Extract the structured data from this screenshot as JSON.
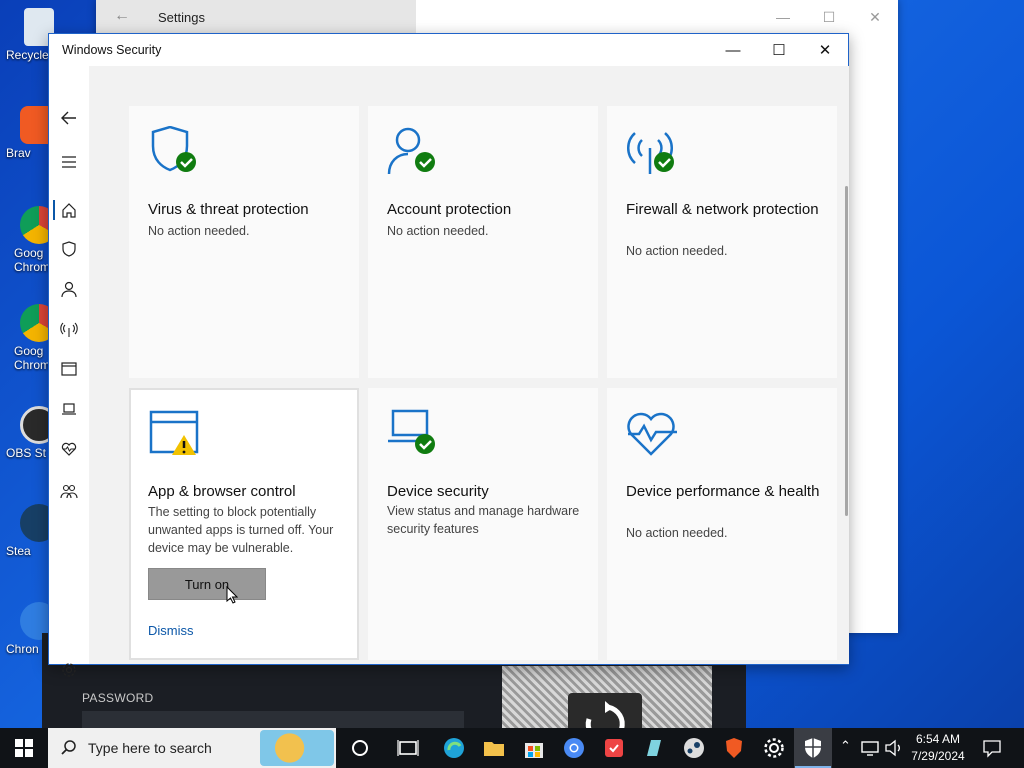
{
  "desktop": {
    "icons": [
      {
        "label": "Recycle",
        "color": "#dfe8f0"
      },
      {
        "label": "Brav",
        "color": "#f05a23"
      },
      {
        "label": "Goog Chrome",
        "color": "#2f7de1"
      },
      {
        "label": "Goog Chrom",
        "color": "#2f7de1"
      },
      {
        "label": "OBS St",
        "color": "#2a2a2a"
      },
      {
        "label": "Stea",
        "color": "#173f66"
      },
      {
        "label": "Chron",
        "color": "#2f7de1"
      }
    ]
  },
  "settings_window": {
    "title": "Settings"
  },
  "dark_app": {
    "password_label": "PASSWORD"
  },
  "security_window": {
    "title": "Windows Security",
    "tiles": [
      {
        "title": "Virus & threat protection",
        "desc": "No action needed.",
        "status": "ok"
      },
      {
        "title": "Account protection",
        "desc": "No action needed.",
        "status": "ok"
      },
      {
        "title": "Firewall & network protection",
        "desc": "No action needed.",
        "status": "ok"
      },
      {
        "title": "App & browser control",
        "desc": "The setting to block potentially unwanted apps is turned off. Your device may be vulnerable.",
        "status": "warning",
        "button": "Turn on",
        "link": "Dismiss"
      },
      {
        "title": "Device security",
        "desc": "View status and manage hardware security features",
        "status": "ok"
      },
      {
        "title": "Device performance & health",
        "desc": "No action needed.",
        "status": "none"
      }
    ]
  },
  "taskbar": {
    "search_placeholder": "Type here to search",
    "time": "6:54 AM",
    "date": "7/29/2024"
  },
  "colors": {
    "accent": "#0b57a8",
    "icon_blue": "#1a73c8",
    "ok_green": "#107c10",
    "warning_yellow": "#f2c200"
  }
}
